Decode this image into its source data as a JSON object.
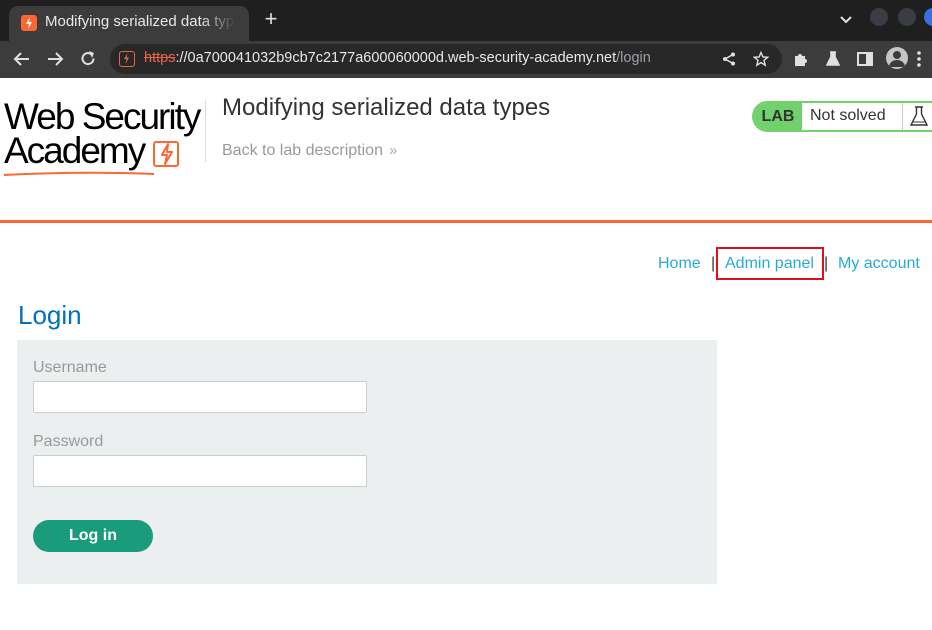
{
  "browser": {
    "tab_title": "Modifying serialized data types",
    "new_tab_label": "+",
    "url_scheme": "https",
    "url_host": "://0a700041032b9cb7c2177a600060000d.web-security-academy.net",
    "url_path": "/login"
  },
  "header": {
    "logo_line1": "Web Security",
    "logo_line2": "Academy",
    "lab_title": "Modifying serialized data types",
    "back_link": "Back to lab description",
    "back_chevrons": "»",
    "lab_badge": "LAB",
    "lab_state": "Not solved",
    "brand_color": "#ff6633",
    "solved_color": "#70d16d"
  },
  "nav": {
    "home": "Home",
    "sep1": "|",
    "admin_panel": "Admin panel",
    "sep2": "|",
    "my_account": "My account",
    "highlight_color": "#e0101a"
  },
  "login": {
    "heading": "Login",
    "username_label": "Username",
    "username_value": "",
    "password_label": "Password",
    "password_value": "",
    "submit_label": "Log in",
    "button_color": "#1a9b7c"
  },
  "icons": [
    "favicon-bolt-icon",
    "plus-icon",
    "chevron-down-icon",
    "back-arrow-icon",
    "forward-arrow-icon",
    "reload-icon",
    "site-info-icon",
    "share-icon",
    "star-icon",
    "puzzle-icon",
    "flask-icon",
    "sidebar-icon",
    "profile-icon",
    "kebab-menu-icon"
  ]
}
